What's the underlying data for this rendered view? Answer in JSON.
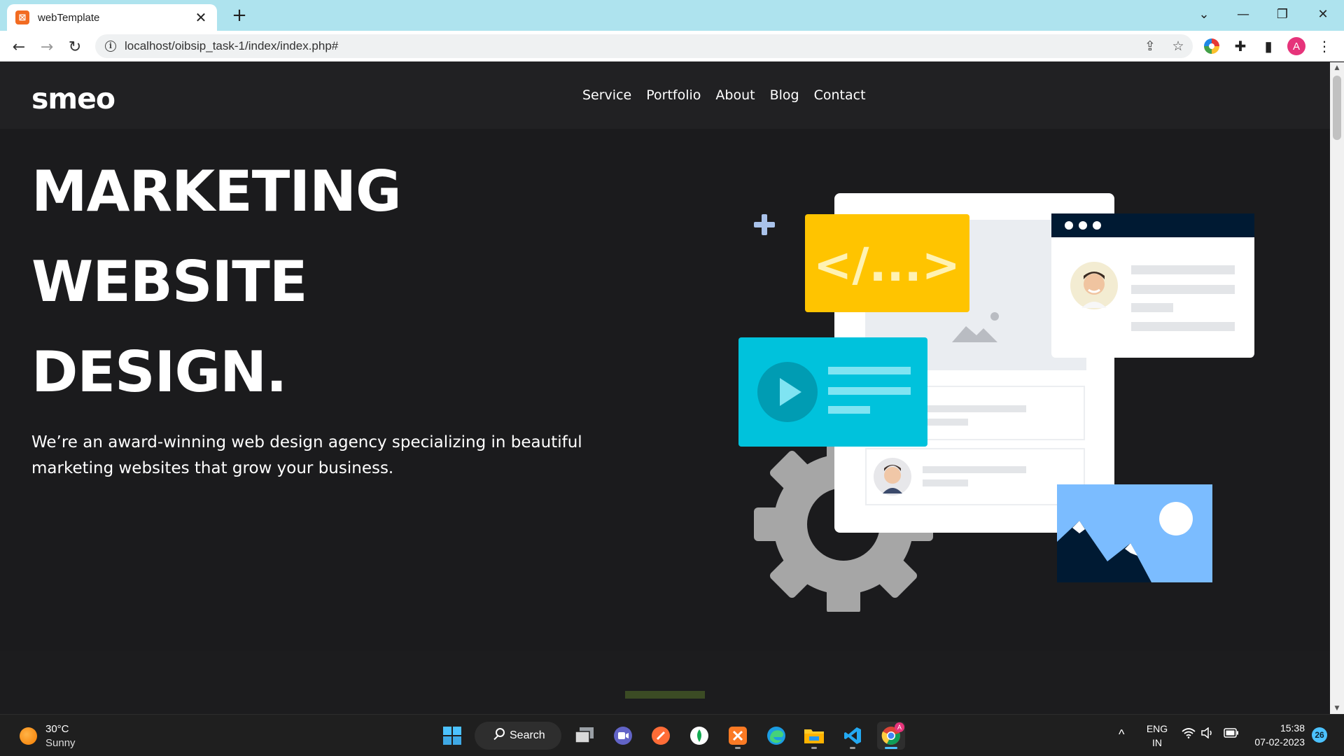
{
  "browser": {
    "tab_title": "webTemplate",
    "tab_favicon": "xampp-icon",
    "new_tab_glyph": "+",
    "url": "localhost/oibsip_task-1/index/index.php#",
    "profile_initial": "A"
  },
  "site": {
    "logo": "smeo",
    "nav": [
      "Service",
      "Portfolio",
      "About",
      "Blog",
      "Contact"
    ],
    "hero_lines": [
      "MARKETING",
      "WEBSITE",
      "DESIGN."
    ],
    "hero_text": "We’re an award-winning web design agency specializing in beautiful marketing websites that grow your business.",
    "code_glyph": "</...>",
    "colors": {
      "background": "#1b1b1d",
      "header": "#212123",
      "code_card": "#ffc400",
      "video_card": "#00c2dc",
      "image_card": "#7bbcff",
      "dark_navy": "#001a33",
      "gear": "#a6a6a6",
      "accent_bar": "#3b4b24"
    }
  },
  "taskbar": {
    "weather_temp": "30°C",
    "weather_condition": "Sunny",
    "search_label": "Search",
    "apps": [
      "start-icon",
      "task-view-icon",
      "teams-chat-icon",
      "postman-icon",
      "mongodb-compass-icon",
      "xampp-icon",
      "edge-icon",
      "file-explorer-icon",
      "vscode-icon",
      "chrome-icon"
    ],
    "language_top": "ENG",
    "language_bottom": "IN",
    "time": "15:38",
    "date": "07-02-2023",
    "notification_count": "26",
    "chrome_badge": "A"
  }
}
